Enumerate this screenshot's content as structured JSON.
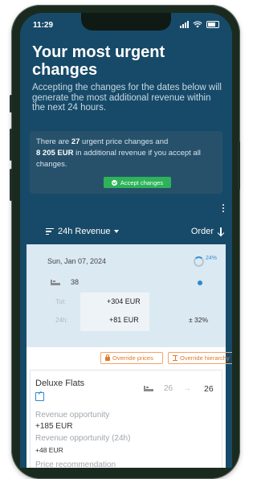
{
  "status_bar": {
    "time": "11:29"
  },
  "header": {
    "title": "Your most urgent changes",
    "intro": "Accepting the changes for the dates below will generate the most additional revenue within the next 24 hours."
  },
  "info": {
    "prefix": "There are",
    "count": "27",
    "mid": "urgent price changes and",
    "amount": "8 205 EUR",
    "suffix": "in additional revenue if you accept all changes.",
    "accept_label": "Accept changes"
  },
  "toolbar": {
    "sort_label": "24h Revenue",
    "order_label": "Order"
  },
  "card": {
    "date": "Sun, Jan 07, 2024",
    "top_pct": "24%",
    "rooms": "38",
    "tot_label": "Tot:",
    "tot_value": "+304 EUR",
    "h24_label": "24h:",
    "h24_value": "+81 EUR",
    "pct_change": "± 32%",
    "override_prices": "Override prices",
    "override_hierarchy": "Override hierarchy"
  },
  "room": {
    "name": "Deluxe Flats",
    "units_from": "26",
    "units_arrow": "→",
    "units_to": "26",
    "rev_label": "Revenue opportunity",
    "rev_value": "+185 EUR",
    "rev24_label": "Revenue opportunity (24h)",
    "rev24_value": "+48 EUR",
    "rec_label": "Price recommendation"
  },
  "colors": {
    "background": "#174a68",
    "accent": "#2db35a",
    "orange": "#e07a2e",
    "blue": "#2c89d0"
  }
}
